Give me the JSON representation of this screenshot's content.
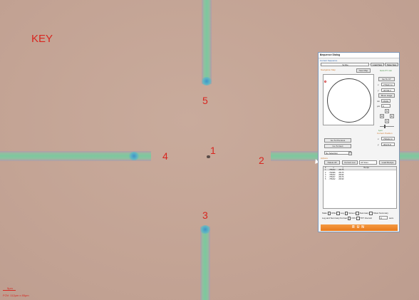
{
  "overlay": {
    "key_label": "KEY",
    "markers": [
      "1",
      "2",
      "3",
      "4",
      "5"
    ],
    "scale_text": "5µm",
    "fov_text": "FOV: 112µm x 85µm"
  },
  "dialog": {
    "title": "Sequence Dialog",
    "close_glyph": "×",
    "current_sequence_label": "Current Sequence",
    "sequence_value": "Scribe",
    "load_seq": "Load Seq",
    "save_seq": "Save Seq",
    "navigation_label": "Navigation Map",
    "new_map": "New Map",
    "goto_label": "Goto XY mm",
    "go_to_xy": "Go To XY",
    "x_label": "x",
    "x_value": "-775217.4",
    "y_label": "y",
    "y_value": "-36709.3",
    "move_stage": "Move stage",
    "nm_label": "nm",
    "nm_value": "15000",
    "um_label": "µm",
    "um_value": "0",
    "jog_up": "▲",
    "jog_down": "▼",
    "jog_left": "◀",
    "jog_right": "▶",
    "jog_n": "N",
    "jog_e": "E",
    "jog_w": "W",
    "jog_s": "S",
    "scale_label": "1µm",
    "current_position_label": "Current Position",
    "pos_x_label": "x",
    "pos_x_value": "-795222.9",
    "pos_y_label": "y",
    "pos_y_value": "-36172.8",
    "go_previous": "Go To Previous",
    "go_next": "Go To Next",
    "no_selection": "No Selection",
    "actions_label": "Actions",
    "delete_all": "Delete All",
    "current_loc": "Current Loc",
    "all_sites": "All Sites",
    "load_recipe": "Load Recipe",
    "table_headers": [
      "#",
      "x",
      "y",
      "Recipe"
    ],
    "table_rows": [
      [
        "1",
        "-795222",
        "-36176",
        ""
      ],
      [
        "2",
        "-794996",
        "-36175",
        ""
      ],
      [
        "3",
        "-795222",
        "-36196",
        ""
      ],
      [
        "4",
        "-795227",
        "-36176",
        ""
      ],
      [
        "5",
        "-795222",
        "-36199",
        ""
      ]
    ],
    "options": {
      "stats": "Stats",
      "dwell": "DWL",
      "log": "Log",
      "screen": "Screen",
      "summary": "Summary",
      "show_summary": "Show Summary"
    },
    "log_format_label": "Log and Summary Format",
    "csv": "CSV",
    "txt": "TXT",
    "interval_label": "Interval",
    "interval_value": "0",
    "interval_unit": "secs",
    "run": "RUN"
  },
  "colors": {
    "annotation": "#d8261f",
    "run_button": "#ef8a2c",
    "dialog_border": "#7f98b8"
  }
}
